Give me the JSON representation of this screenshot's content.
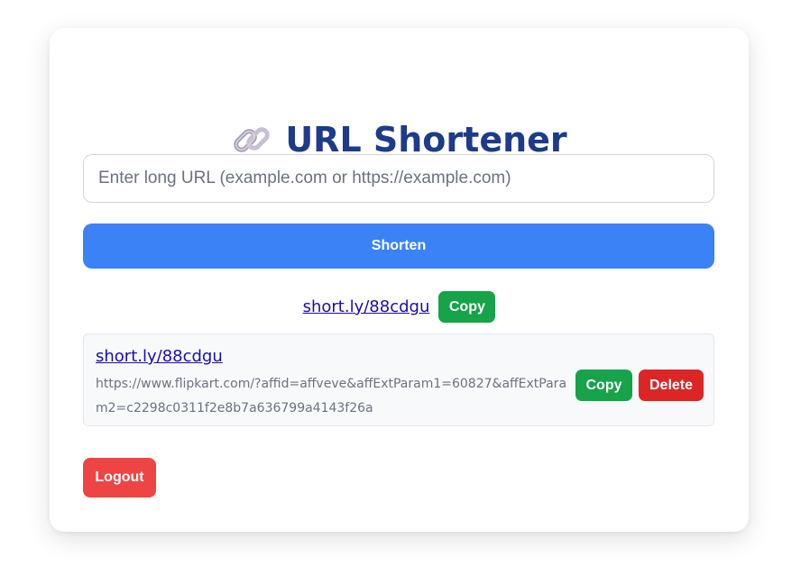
{
  "app": {
    "title": "URL Shortener",
    "title_icon": "link-icon"
  },
  "form": {
    "url_input_value": "",
    "url_input_placeholder": "Enter long URL (example.com or https://example.com)",
    "shorten_label": "Shorten"
  },
  "result": {
    "short_url": "short.ly/88cdgu",
    "copy_label": "Copy"
  },
  "links": [
    {
      "short_url": "short.ly/88cdgu",
      "long_url": "https://www.flipkart.com/?affid=affveve&affExtParam1=60827&affExtParam2=c2298c0311f2e8b7a636799a4143f26a",
      "copy_label": "Copy",
      "delete_label": "Delete"
    }
  ],
  "account": {
    "logout_label": "Logout"
  },
  "colors": {
    "title": "#1e3a8a",
    "primary": "#3b82f6",
    "success": "#16a34a",
    "danger": "#dc2626",
    "logout": "#ef4444",
    "link": "#1a0dab"
  }
}
